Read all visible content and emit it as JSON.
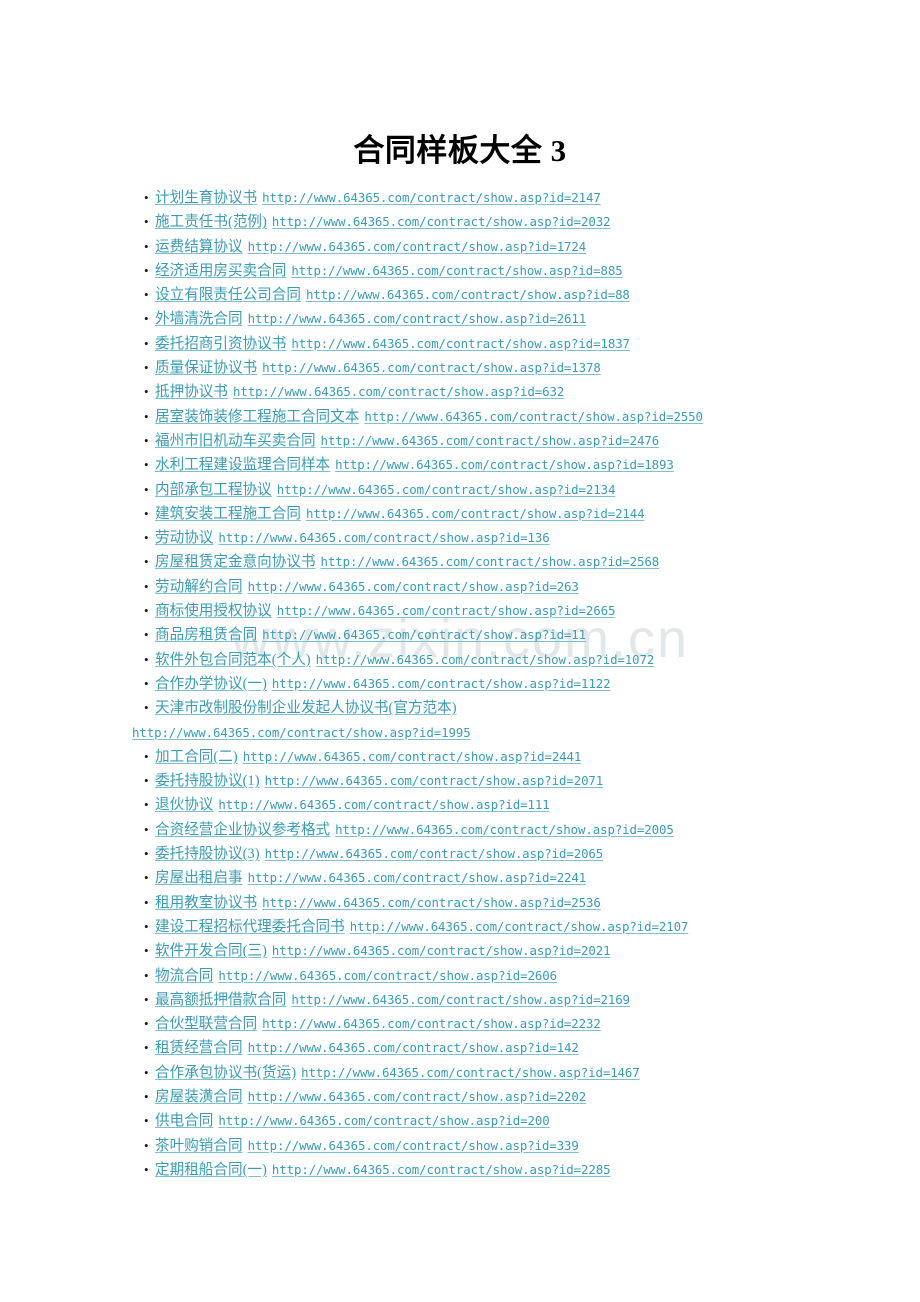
{
  "document": {
    "title": "合同样板大全 3",
    "watermark": "www.zixin.com.cn",
    "bullet_glyph": "•",
    "link_color": "#3b9cb3",
    "title_color": "#000000",
    "watermark_color": "#e2e8ea",
    "background_color": "#ffffff"
  },
  "links": [
    {
      "label": "计划生育协议书",
      "url": "http://www.64365.com/contract/show.asp?id=2147",
      "wrapped": false
    },
    {
      "label": "施工责任书(范例)",
      "url": "http://www.64365.com/contract/show.asp?id=2032",
      "wrapped": false
    },
    {
      "label": "运费结算协议",
      "url": "http://www.64365.com/contract/show.asp?id=1724",
      "wrapped": false
    },
    {
      "label": "经济适用房买卖合同",
      "url": "http://www.64365.com/contract/show.asp?id=885",
      "wrapped": false
    },
    {
      "label": "设立有限责任公司合同",
      "url": "http://www.64365.com/contract/show.asp?id=88",
      "wrapped": false
    },
    {
      "label": "外墙清洗合同",
      "url": "http://www.64365.com/contract/show.asp?id=2611",
      "wrapped": false
    },
    {
      "label": "委托招商引资协议书",
      "url": "http://www.64365.com/contract/show.asp?id=1837",
      "wrapped": false
    },
    {
      "label": "质量保证协议书",
      "url": "http://www.64365.com/contract/show.asp?id=1378",
      "wrapped": false
    },
    {
      "label": "抵押协议书",
      "url": "http://www.64365.com/contract/show.asp?id=632",
      "wrapped": false
    },
    {
      "label": "居室装饰装修工程施工合同文本",
      "url": "http://www.64365.com/contract/show.asp?id=2550",
      "wrapped": false
    },
    {
      "label": "福州市旧机动车买卖合同",
      "url": "http://www.64365.com/contract/show.asp?id=2476",
      "wrapped": false
    },
    {
      "label": "水利工程建设监理合同样本",
      "url": "http://www.64365.com/contract/show.asp?id=1893",
      "wrapped": false
    },
    {
      "label": "内部承包工程协议",
      "url": "http://www.64365.com/contract/show.asp?id=2134",
      "wrapped": false
    },
    {
      "label": "建筑安装工程施工合同",
      "url": "http://www.64365.com/contract/show.asp?id=2144",
      "wrapped": false
    },
    {
      "label": "劳动协议",
      "url": "http://www.64365.com/contract/show.asp?id=136",
      "wrapped": false
    },
    {
      "label": "房屋租赁定金意向协议书",
      "url": "http://www.64365.com/contract/show.asp?id=2568",
      "wrapped": false
    },
    {
      "label": "劳动解约合同",
      "url": "http://www.64365.com/contract/show.asp?id=263",
      "wrapped": false
    },
    {
      "label": "商标使用授权协议",
      "url": "http://www.64365.com/contract/show.asp?id=2665",
      "wrapped": false
    },
    {
      "label": "商品房租赁合同",
      "url": "http://www.64365.com/contract/show.asp?id=11",
      "wrapped": false
    },
    {
      "label": "软件外包合同范本(个人)",
      "url": "http://www.64365.com/contract/show.asp?id=1072",
      "wrapped": false
    },
    {
      "label": "合作办学协议(一)",
      "url": "http://www.64365.com/contract/show.asp?id=1122",
      "wrapped": false
    },
    {
      "label": "天津市改制股份制企业发起人协议书(官方范本)",
      "url": "http://www.64365.com/contract/show.asp?id=1995",
      "wrapped": true
    },
    {
      "label": "加工合同(二)",
      "url": "http://www.64365.com/contract/show.asp?id=2441",
      "wrapped": false
    },
    {
      "label": "委托持股协议(1)",
      "url": "http://www.64365.com/contract/show.asp?id=2071",
      "wrapped": false
    },
    {
      "label": "退伙协议",
      "url": "http://www.64365.com/contract/show.asp?id=111",
      "wrapped": false
    },
    {
      "label": "合资经营企业协议参考格式",
      "url": "http://www.64365.com/contract/show.asp?id=2005",
      "wrapped": false
    },
    {
      "label": "委托持股协议(3)",
      "url": "http://www.64365.com/contract/show.asp?id=2065",
      "wrapped": false
    },
    {
      "label": "房屋出租启事",
      "url": "http://www.64365.com/contract/show.asp?id=2241",
      "wrapped": false
    },
    {
      "label": "租用教室协议书",
      "url": "http://www.64365.com/contract/show.asp?id=2536",
      "wrapped": false
    },
    {
      "label": "建设工程招标代理委托合同书",
      "url": "http://www.64365.com/contract/show.asp?id=2107",
      "wrapped": false
    },
    {
      "label": "软件开发合同(三)",
      "url": "http://www.64365.com/contract/show.asp?id=2021",
      "wrapped": false
    },
    {
      "label": "物流合同",
      "url": "http://www.64365.com/contract/show.asp?id=2606",
      "wrapped": false
    },
    {
      "label": "最高额抵押借款合同",
      "url": "http://www.64365.com/contract/show.asp?id=2169",
      "wrapped": false
    },
    {
      "label": "合伙型联营合同",
      "url": "http://www.64365.com/contract/show.asp?id=2232",
      "wrapped": false
    },
    {
      "label": "租赁经营合同",
      "url": "http://www.64365.com/contract/show.asp?id=142",
      "wrapped": false
    },
    {
      "label": "合作承包协议书(货运)",
      "url": "http://www.64365.com/contract/show.asp?id=1467",
      "wrapped": false
    },
    {
      "label": "房屋装潢合同",
      "url": "http://www.64365.com/contract/show.asp?id=2202",
      "wrapped": false
    },
    {
      "label": "供电合同",
      "url": "http://www.64365.com/contract/show.asp?id=200",
      "wrapped": false
    },
    {
      "label": "茶叶购销合同",
      "url": "http://www.64365.com/contract/show.asp?id=339",
      "wrapped": false
    },
    {
      "label": "定期租船合同(一)",
      "url": "http://www.64365.com/contract/show.asp?id=2285",
      "wrapped": false
    }
  ]
}
